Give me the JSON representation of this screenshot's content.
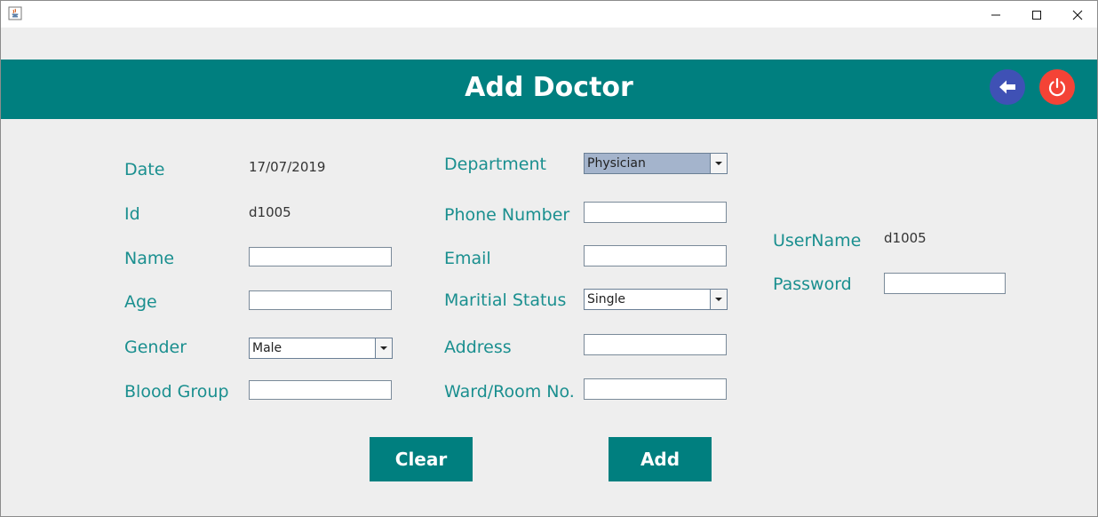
{
  "window": {
    "icon": "java-cup-icon",
    "controls": [
      "minimize-icon",
      "maximize-icon",
      "close-icon"
    ]
  },
  "header": {
    "title": "Add Doctor",
    "back_icon": "arrow-left-icon",
    "power_icon": "power-icon",
    "colors": {
      "bar": "#007f7f",
      "back": "#3f51b5",
      "power": "#f44336"
    }
  },
  "form": {
    "date_label": "Date",
    "date_value": "17/07/2019",
    "id_label": "Id",
    "id_value": "d1005",
    "name_label": "Name",
    "name_value": "",
    "age_label": "Age",
    "age_value": "",
    "gender_label": "Gender",
    "gender_value": "Male",
    "blood_label": "Blood Group",
    "blood_value": "",
    "department_label": "Department",
    "department_value": "Physician",
    "phone_label": "Phone Number",
    "phone_value": "",
    "email_label": "Email",
    "email_value": "",
    "marital_label": "Maritial Status",
    "marital_value": "Single",
    "address_label": "Address",
    "address_value": "",
    "ward_label": "Ward/Room No.",
    "ward_value": "",
    "username_label": "UserName",
    "username_value": "d1005",
    "password_label": "Password",
    "password_value": ""
  },
  "buttons": {
    "clear": "Clear",
    "add": "Add"
  }
}
